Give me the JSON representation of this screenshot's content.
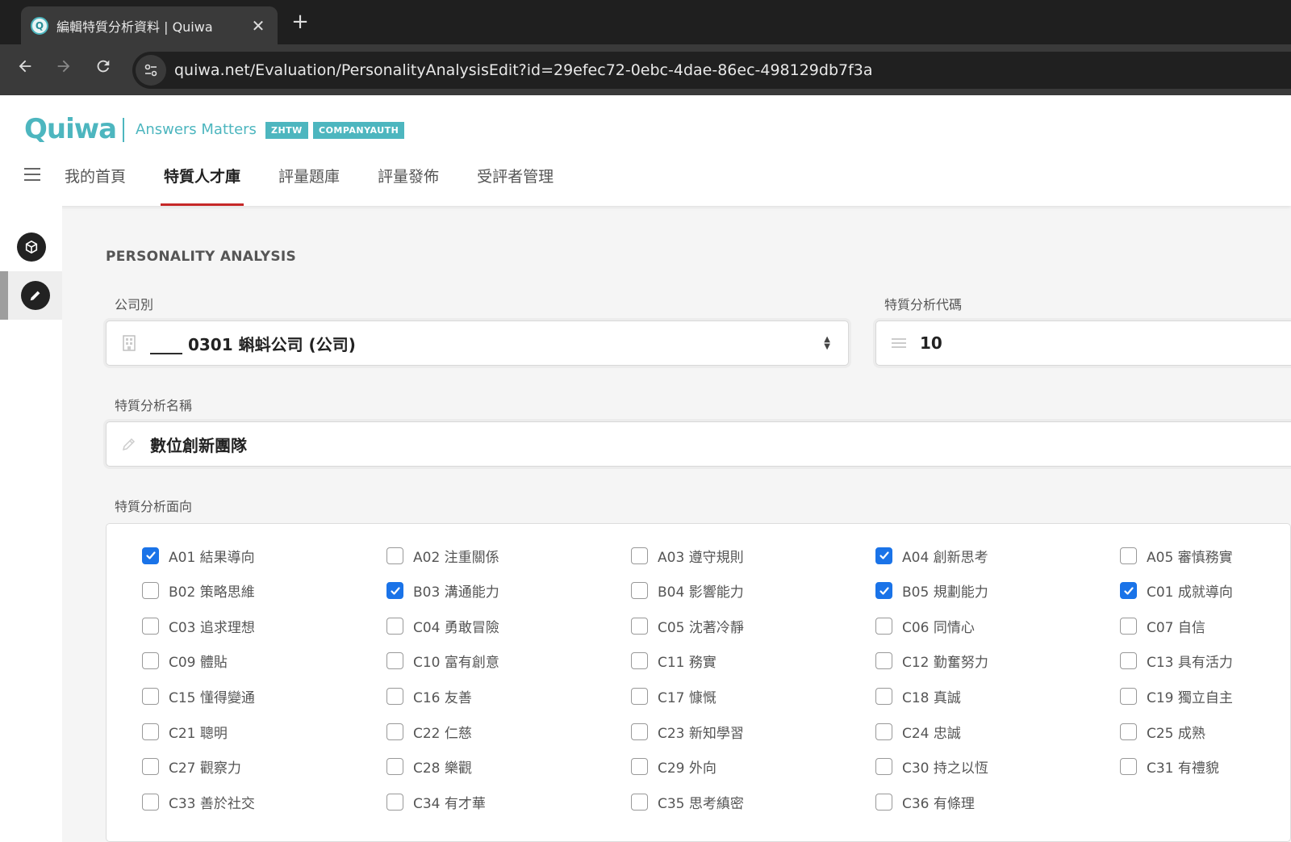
{
  "browser": {
    "tab_title": "編輯特質分析資料 | Quiwa",
    "tab_favicon": "Q",
    "close_glyph": "✕",
    "new_tab_glyph": "+",
    "url": "quiwa.net/Evaluation/PersonalityAnalysisEdit?id=29efec72-0ebc-4dae-86ec-498129db7f3a"
  },
  "header": {
    "logo": "Quiwa",
    "tagline": "Answers Matters",
    "badges": [
      "ZHTW",
      "COMPANYAUTH"
    ],
    "nav": [
      {
        "label": "我的首頁",
        "active": false
      },
      {
        "label": "特質人才庫",
        "active": true
      },
      {
        "label": "評量題庫",
        "active": false
      },
      {
        "label": "評量發佈",
        "active": false
      },
      {
        "label": "受評者管理",
        "active": false
      }
    ]
  },
  "page": {
    "section_title": "PERSONALITY ANALYSIS",
    "company_label": "公司別",
    "company_value": "____ 0301 蝌蚪公司 (公司)",
    "code_label": "特質分析代碼",
    "code_value": "10",
    "name_label": "特質分析名稱",
    "name_value": "數位創新團隊",
    "facet_label": "特質分析面向"
  },
  "facets": [
    {
      "label": "A01 結果導向",
      "checked": true
    },
    {
      "label": "A02 注重關係",
      "checked": false
    },
    {
      "label": "A03 遵守規則",
      "checked": false
    },
    {
      "label": "A04 創新思考",
      "checked": true
    },
    {
      "label": "A05 審慎務實",
      "checked": false
    },
    {
      "label": "B02 策略思維",
      "checked": false
    },
    {
      "label": "B03 溝通能力",
      "checked": true
    },
    {
      "label": "B04 影響能力",
      "checked": false
    },
    {
      "label": "B05 規劃能力",
      "checked": true
    },
    {
      "label": "C01 成就導向",
      "checked": true
    },
    {
      "label": "C03 追求理想",
      "checked": false
    },
    {
      "label": "C04 勇敢冒險",
      "checked": false
    },
    {
      "label": "C05 沈著冷靜",
      "checked": false
    },
    {
      "label": "C06 同情心",
      "checked": false
    },
    {
      "label": "C07 自信",
      "checked": false
    },
    {
      "label": "C09 體貼",
      "checked": false
    },
    {
      "label": "C10 富有創意",
      "checked": false
    },
    {
      "label": "C11 務實",
      "checked": false
    },
    {
      "label": "C12 勤奮努力",
      "checked": false
    },
    {
      "label": "C13 具有活力",
      "checked": false
    },
    {
      "label": "C15 懂得變通",
      "checked": false
    },
    {
      "label": "C16 友善",
      "checked": false
    },
    {
      "label": "C17 慷慨",
      "checked": false
    },
    {
      "label": "C18 真誠",
      "checked": false
    },
    {
      "label": "C19 獨立自主",
      "checked": false
    },
    {
      "label": "C21 聰明",
      "checked": false
    },
    {
      "label": "C22 仁慈",
      "checked": false
    },
    {
      "label": "C23 新知學習",
      "checked": false
    },
    {
      "label": "C24 忠誠",
      "checked": false
    },
    {
      "label": "C25 成熟",
      "checked": false
    },
    {
      "label": "C27 觀察力",
      "checked": false
    },
    {
      "label": "C28 樂觀",
      "checked": false
    },
    {
      "label": "C29 外向",
      "checked": false
    },
    {
      "label": "C30 持之以恆",
      "checked": false
    },
    {
      "label": "C31 有禮貌",
      "checked": false
    },
    {
      "label": "C33 善於社交",
      "checked": false
    },
    {
      "label": "C34 有才華",
      "checked": false
    },
    {
      "label": "C35 思考縝密",
      "checked": false
    },
    {
      "label": "C36 有條理",
      "checked": false
    }
  ],
  "colors": {
    "brand": "#4db6bf",
    "active_tab_underline": "#c62828",
    "checkbox_checked": "#1a73e8"
  },
  "icons": {
    "tab_favicon": "quiwa-favicon-icon",
    "back": "back-arrow-icon",
    "forward": "forward-arrow-icon",
    "reload": "reload-icon",
    "site_info": "tune-icon",
    "menu": "hamburger-menu-icon",
    "rail_1": "cube-icon",
    "rail_2": "pencil-icon",
    "company_field": "building-icon",
    "code_field": "list-lines-icon",
    "name_field": "pencil-icon",
    "select": "sort-arrows-icon"
  }
}
